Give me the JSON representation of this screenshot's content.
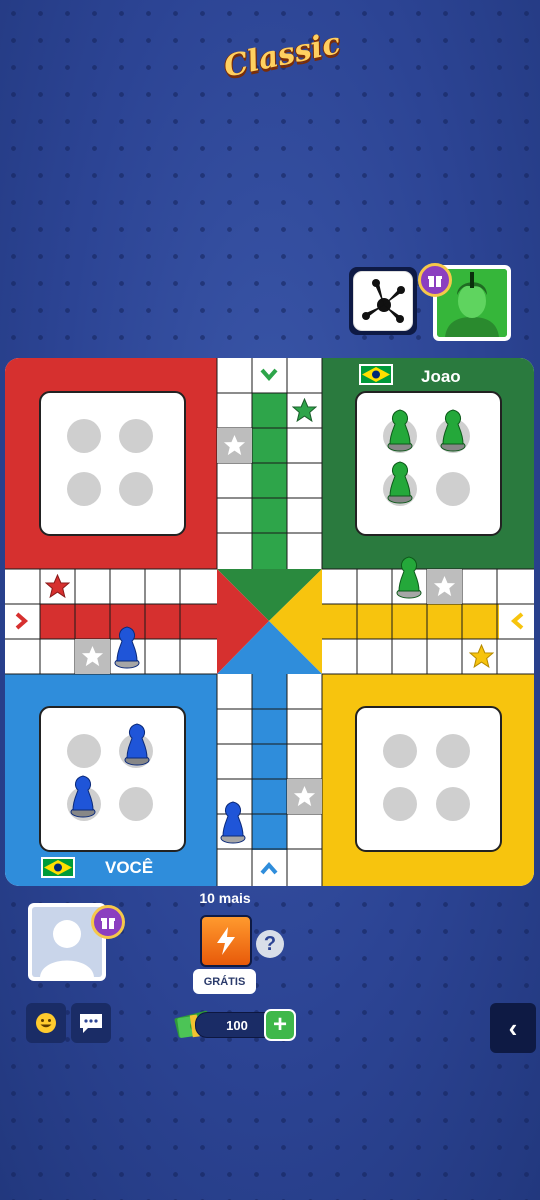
{
  "header": {
    "logo_text": "Classic"
  },
  "opponent": {
    "name": "Joao",
    "country": "Brazil",
    "avatar_color": "#36b63a"
  },
  "player": {
    "name": "VOCÊ",
    "country": "Brazil"
  },
  "colors": {
    "red": "#d6302f",
    "green": "#2a7a3e",
    "yellow": "#f7c40e",
    "blue": "#2f8ddb",
    "lane_red": "#d6302f",
    "lane_green": "#2ea54a",
    "lane_yellow": "#f7c40e",
    "lane_blue": "#2f8ddb",
    "background": "#2c4494"
  },
  "bonus": {
    "label": "10 mais",
    "free_label": "GRÁTIS",
    "icon": "lightning-icon"
  },
  "wallet": {
    "amount": "100",
    "icon": "cash-icon"
  },
  "controls": {
    "emoji_icon": "smiley-icon",
    "chat_icon": "chat-icon",
    "back_icon": "chevron-left-icon",
    "help_label": "?"
  },
  "pieces": {
    "green_home": 3,
    "green_on_track": 1,
    "blue_home": 2,
    "blue_on_track": 2,
    "red_home": 0,
    "yellow_home": 0
  }
}
